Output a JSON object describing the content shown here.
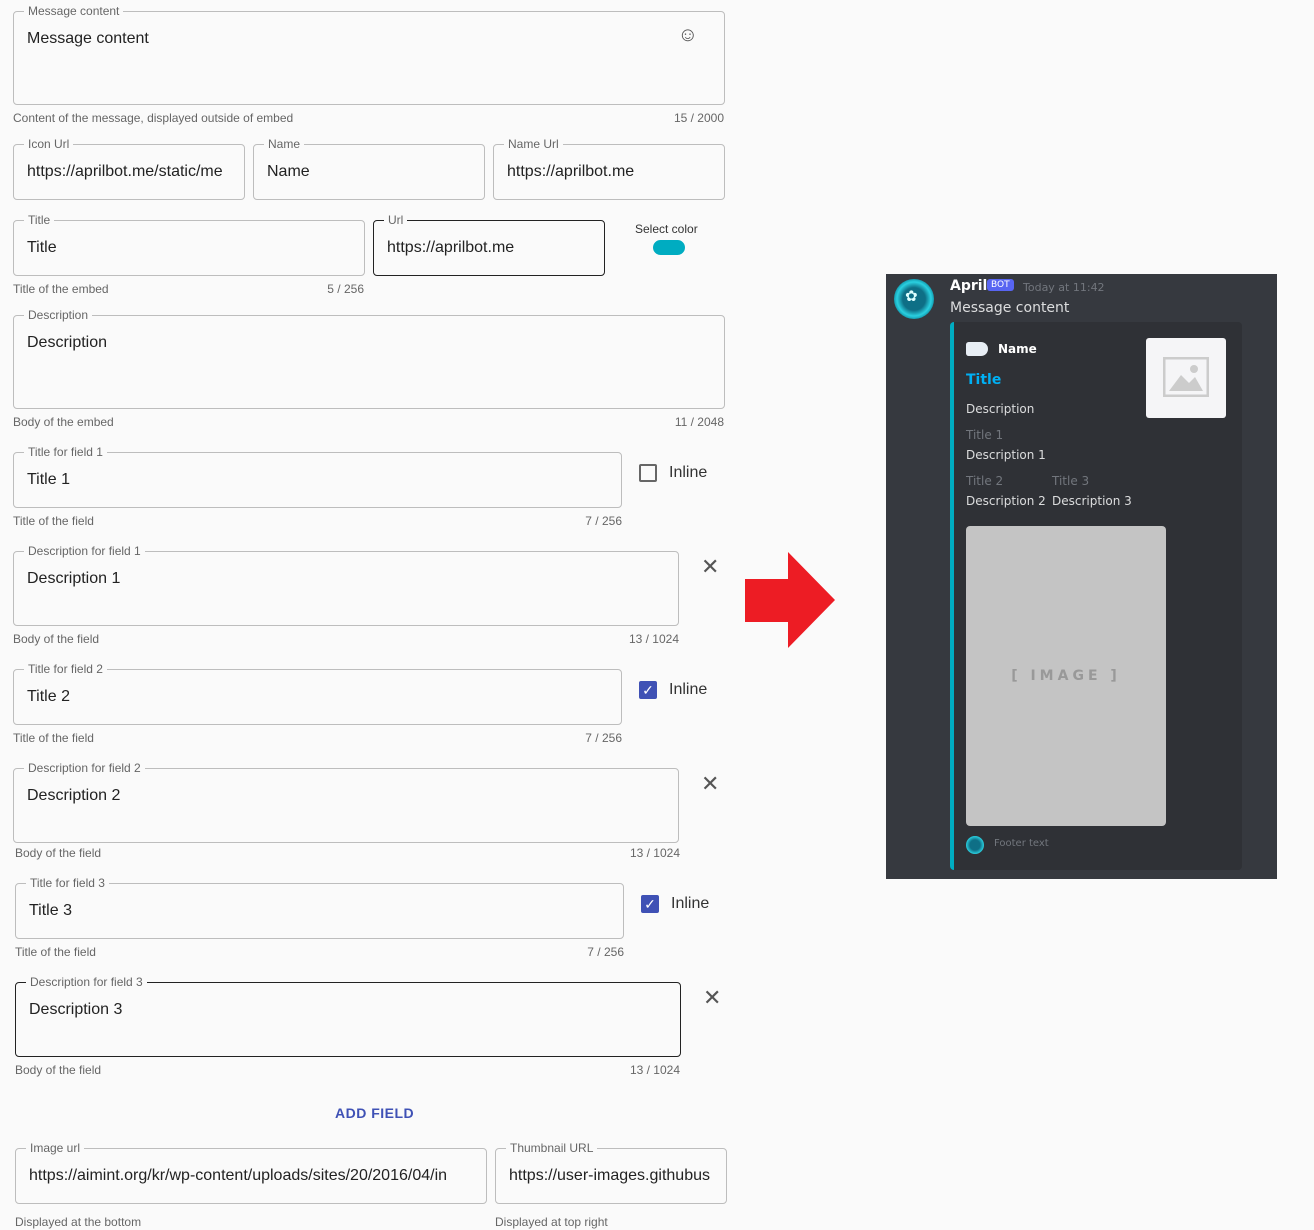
{
  "form": {
    "message": {
      "label": "Message content",
      "value": "Message content",
      "helper": "Content of the message, displayed outside of embed",
      "counter": "15 / 2000"
    },
    "icon_url": {
      "label": "Icon Url",
      "value": "https://aprilbot.me/static/me"
    },
    "name": {
      "label": "Name",
      "value": "Name"
    },
    "name_url": {
      "label": "Name Url",
      "value": "https://aprilbot.me"
    },
    "title": {
      "label": "Title",
      "value": "Title",
      "helper": "Title of the embed",
      "counter": "5 / 256"
    },
    "url": {
      "label": "Url",
      "value": "https://aprilbot.me"
    },
    "select_color": {
      "label": "Select color",
      "color": "#00acc1"
    },
    "description": {
      "label": "Description",
      "value": "Description",
      "helper": "Body of the embed",
      "counter": "11 / 2048"
    },
    "fields": [
      {
        "title_label": "Title for field 1",
        "title": "Title 1",
        "title_helper": "Title of the field",
        "title_counter": "7 / 256",
        "inline": false,
        "desc_label": "Description for field 1",
        "desc": "Description 1",
        "desc_helper": "Body of the field",
        "desc_counter": "13 / 1024"
      },
      {
        "title_label": "Title for field 2",
        "title": "Title 2",
        "title_helper": "Title of the field",
        "title_counter": "7 / 256",
        "inline": true,
        "desc_label": "Description for field 2",
        "desc": "Description 2",
        "desc_helper": "Body of the field",
        "desc_counter": "13 / 1024"
      },
      {
        "title_label": "Title for field 3",
        "title": "Title 3",
        "title_helper": "Title of the field",
        "title_counter": "7 / 256",
        "inline": true,
        "desc_label": "Description for field 3",
        "desc": "Description 3",
        "desc_helper": "Body of the field",
        "desc_counter": "13 / 1024"
      }
    ],
    "inline_label": "Inline",
    "add_field": "ADD FIELD",
    "image_url": {
      "label": "Image url",
      "value": "https://aimint.org/kr/wp-content/uploads/sites/20/2016/04/in",
      "helper": "Displayed at the bottom"
    },
    "thumbnail_url": {
      "label": "Thumbnail URL",
      "value": "https://user-images.githubus",
      "helper": "Displayed at top right"
    }
  },
  "preview": {
    "username": "April",
    "bot_tag": "BOT",
    "timestamp": "Today at 11:42",
    "content": "Message content",
    "author_name": "Name",
    "title": "Title",
    "description": "Description",
    "fields": [
      {
        "name": "Title 1",
        "value": "Description 1"
      },
      {
        "name": "Title 2",
        "value": "Description 2"
      },
      {
        "name": "Title 3",
        "value": "Description 3"
      }
    ],
    "image_text": "[ IMAGE ]",
    "footer": "Footer text",
    "embed_color": "#00acc1"
  }
}
